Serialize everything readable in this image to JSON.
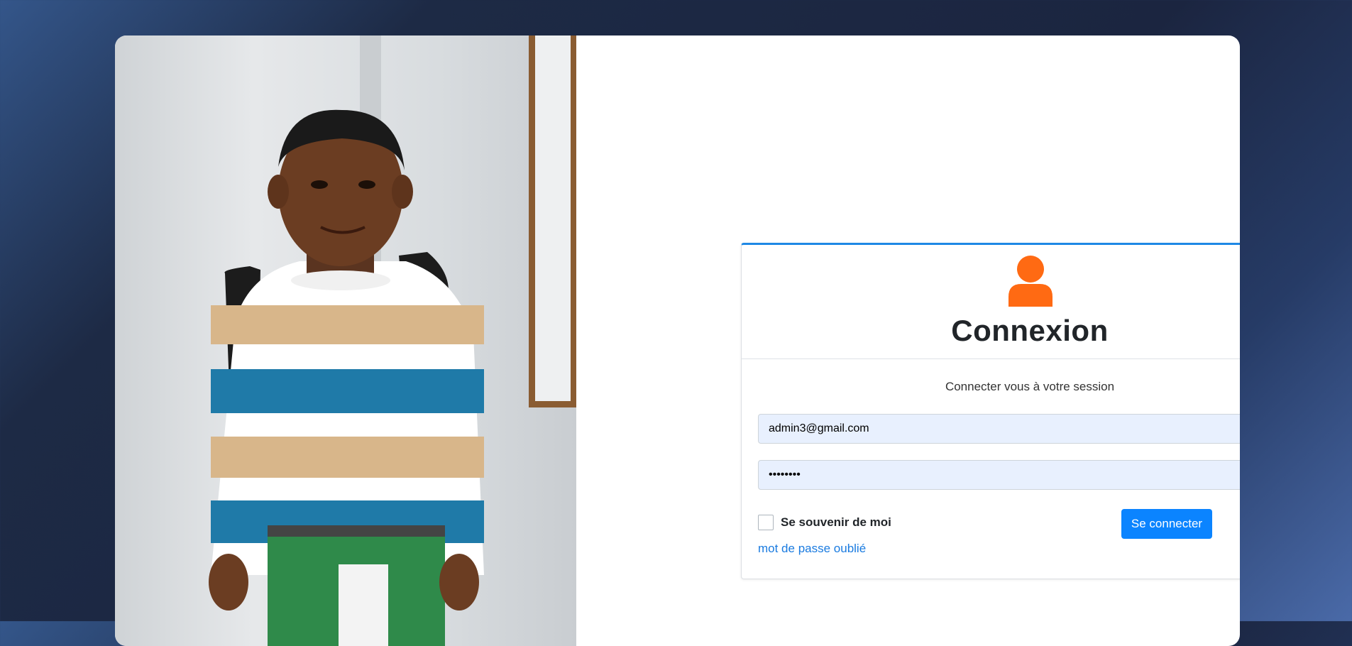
{
  "login": {
    "title": "Connexion",
    "subtitle": "Connecter vous à votre session",
    "email_value": "admin3@gmail.com",
    "password_value": "••••••••",
    "remember_label": "Se souvenir de moi",
    "submit_label": "Se connecter",
    "forgot_label": "mot de passe oublié"
  },
  "icons": {
    "user": "user-icon",
    "email": "envelope-icon",
    "password": "lock-icon"
  },
  "colors": {
    "accent": "#0b84ff",
    "box_top_border": "#1e88e5",
    "user_icon": "#ff6a13",
    "input_bg": "#e8f0fe"
  }
}
